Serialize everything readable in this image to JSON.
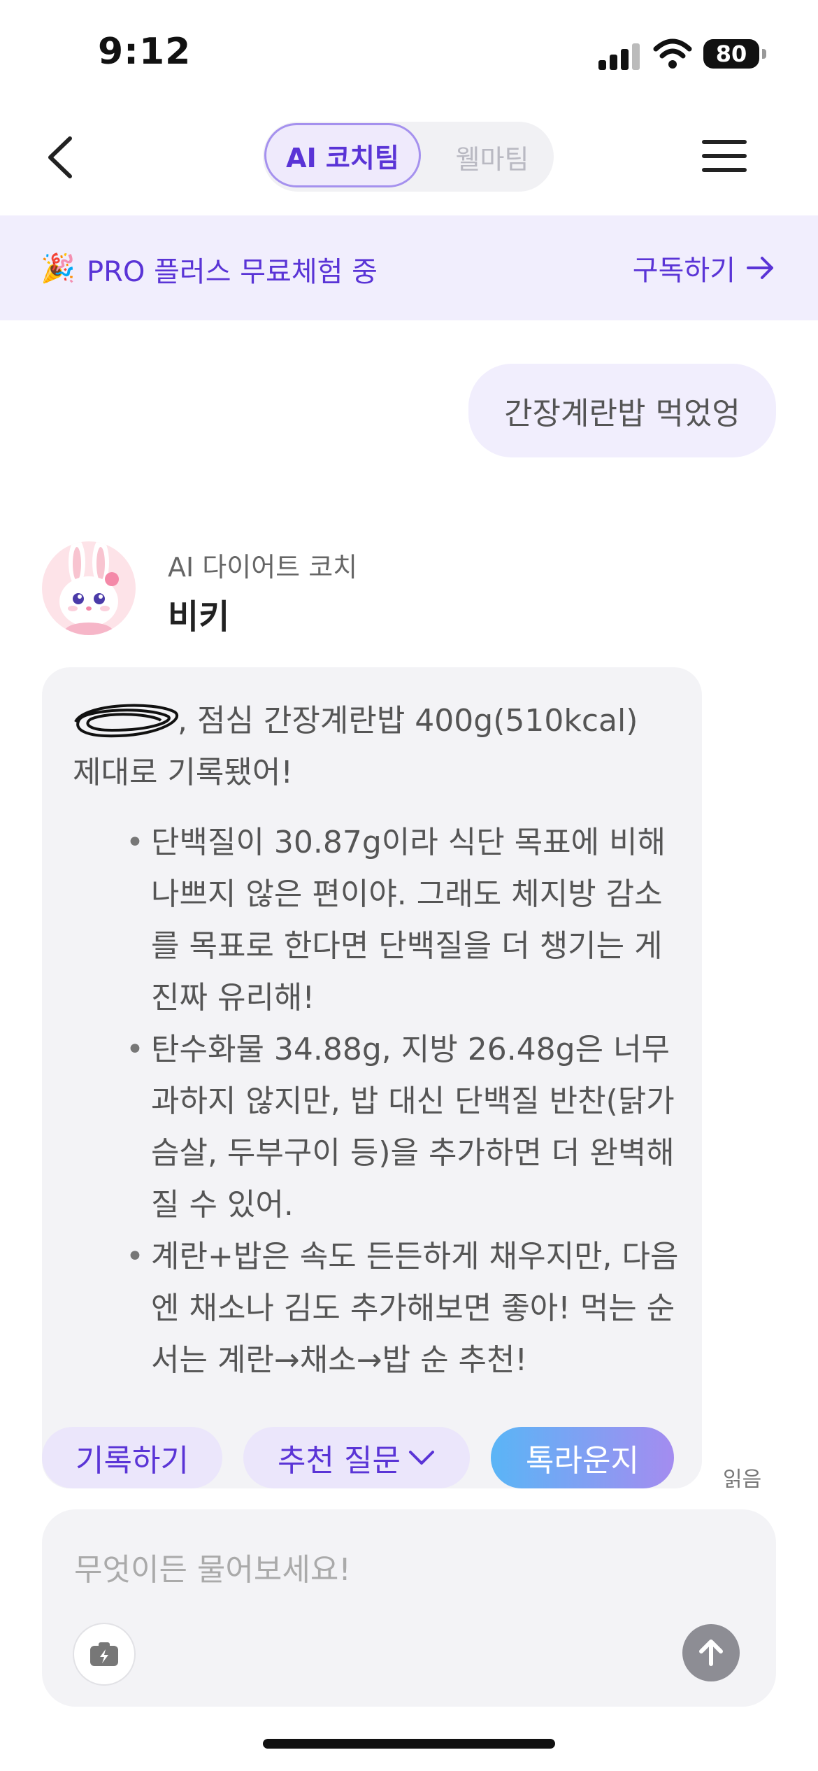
{
  "status_bar": {
    "time": "9:12",
    "battery": "80"
  },
  "nav": {
    "tab_active": "AI 코치팀",
    "tab_inactive": "웰마팀"
  },
  "promo": {
    "text": "PRO 플러스 무료체험 중",
    "cta": "구독하기"
  },
  "chat": {
    "user_message": "간장계란밥 먹었엉",
    "coach_role": "AI 다이어트 코치",
    "coach_name": "비키",
    "bot_intro_1": ", 점심 간장계란밥 400g(510kcal)",
    "bot_intro_2": "제대로 기록됐어!",
    "bullets": [
      "단백질이 30.87g이라 식단 목표에 비해 나쁘지 않은 편이야. 그래도 체지방 감소를 목표로 한다면 단백질을 더 챙기는 게 진짜 유리해!",
      "탄수화물 34.88g, 지방 26.48g은 너무 과하지 않지만, 밥 대신 단백질 반찬(닭가슴살, 두부구이 등)을 추가하면 더 완벽해질 수 있어.",
      "계란+밥은 속도 든든하게 채우지만, 다음엔 채소나 김도 추가해보면 좋아! 먹는 순서는 계란→채소→밥 순 추천!"
    ],
    "read_label": "읽음"
  },
  "chips": {
    "record": "기록하기",
    "questions": "추천 질문",
    "talk": "톡라운지"
  },
  "composer": {
    "placeholder": "무엇이든 물어보세요!"
  },
  "icons": {
    "back": "chevron-left-icon",
    "menu": "hamburger-icon",
    "party": "party-popper-icon",
    "arrow": "arrow-right-icon",
    "camera": "camera-icon",
    "send": "arrow-up-icon"
  },
  "colors": {
    "accent": "#5a34d6",
    "banner_bg": "#f1eefd",
    "bubble_bg": "#f3f3f6"
  }
}
